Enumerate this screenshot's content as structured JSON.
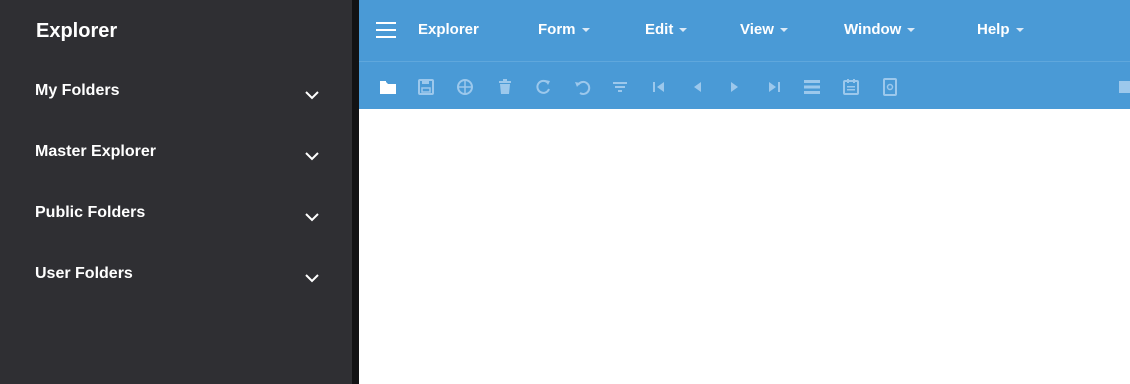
{
  "sidebar": {
    "title": "Explorer",
    "items": [
      {
        "label": "My Folders",
        "icon": "chevron-down-icon"
      },
      {
        "label": "Master Explorer",
        "icon": "chevron-down-icon"
      },
      {
        "label": "Public Folders",
        "icon": "chevron-down-icon"
      },
      {
        "label": "User Folders",
        "icon": "chevron-down-icon"
      }
    ]
  },
  "menubar": {
    "icon": "hamburger-menu-icon",
    "title": "Explorer",
    "menus": [
      {
        "label": "Form"
      },
      {
        "label": "Edit"
      },
      {
        "label": "View"
      },
      {
        "label": "Window"
      },
      {
        "label": "Help"
      }
    ]
  },
  "toolbar": {
    "icons": [
      "open-folder-icon",
      "save-icon",
      "globe-icon",
      "delete-icon",
      "refresh-icon",
      "undo-icon",
      "filter-icon",
      "first-record-icon",
      "previous-record-icon",
      "next-record-icon",
      "last-record-icon",
      "list-view-icon",
      "calendar-icon",
      "document-icon"
    ]
  },
  "colors": {
    "sidebar_bg": "#2f2f33",
    "header_blue": "#4a9ad6",
    "icon_muted": "#9cc8ec",
    "text_white": "#ffffff"
  }
}
